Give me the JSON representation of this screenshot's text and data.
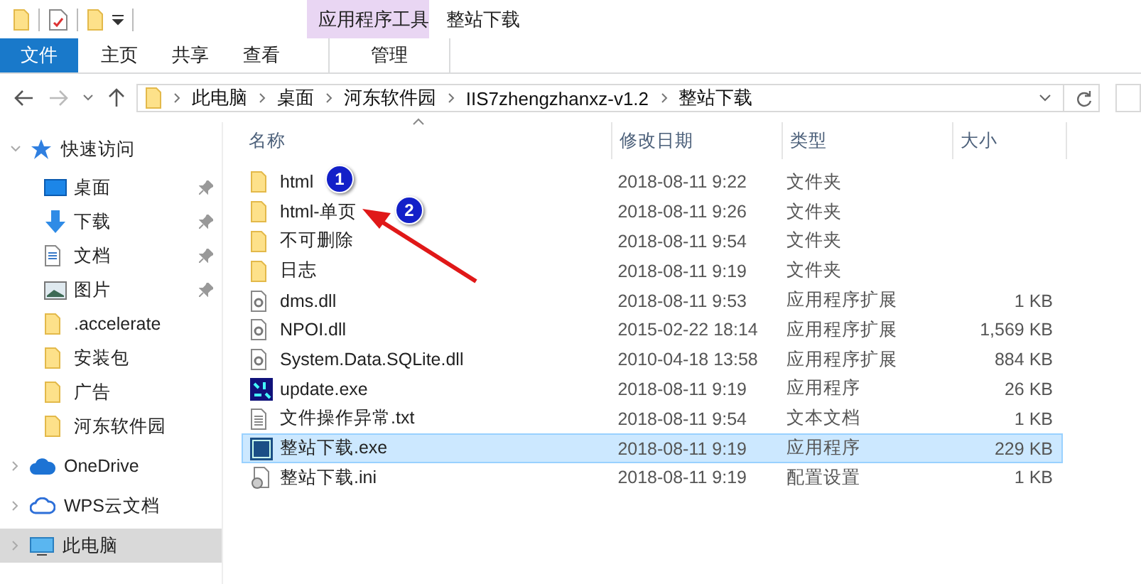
{
  "title_bar": {
    "context_group": "应用程序工具",
    "title": "整站下载"
  },
  "ribbon_tabs": [
    {
      "label": "文件",
      "kind": "file"
    },
    {
      "label": "主页",
      "kind": "normal"
    },
    {
      "label": "共享",
      "kind": "normal"
    },
    {
      "label": "查看",
      "kind": "normal"
    },
    {
      "label": "管理",
      "kind": "context"
    }
  ],
  "address_bar": {
    "crumbs": [
      "此电脑",
      "桌面",
      "河东软件园",
      "IIS7zhengzhanxz-v1.2",
      "整站下载"
    ]
  },
  "nav_pane": [
    {
      "label": "快速访问",
      "kind": "star",
      "expanded": true,
      "selected": false,
      "children": [
        {
          "label": "桌面",
          "kind": "desktop",
          "pinned": true
        },
        {
          "label": "下载",
          "kind": "download",
          "pinned": true
        },
        {
          "label": "文档",
          "kind": "document",
          "pinned": true
        },
        {
          "label": "图片",
          "kind": "image",
          "pinned": true
        },
        {
          "label": ".accelerate",
          "kind": "folder",
          "pinned": false
        },
        {
          "label": "安装包",
          "kind": "folder",
          "pinned": false
        },
        {
          "label": "广告",
          "kind": "folder",
          "pinned": false
        },
        {
          "label": "河东软件园",
          "kind": "folder",
          "pinned": false
        }
      ]
    },
    {
      "label": "OneDrive",
      "kind": "cloud",
      "expanded": false,
      "selected": false
    },
    {
      "label": "WPS云文档",
      "kind": "cloud-outline",
      "expanded": false,
      "selected": false
    },
    {
      "label": "此电脑",
      "kind": "computer",
      "expanded": false,
      "selected": true
    }
  ],
  "columns": [
    {
      "label": "名称",
      "sorted": true
    },
    {
      "label": "修改日期",
      "sorted": false
    },
    {
      "label": "类型",
      "sorted": false
    },
    {
      "label": "大小",
      "sorted": false
    }
  ],
  "files": [
    {
      "name": "html",
      "date": "2018-08-11 9:22",
      "type": "文件夹",
      "kind": "folder",
      "selected": false
    },
    {
      "name": "html-单页",
      "date": "2018-08-11 9:26",
      "type": "文件夹",
      "kind": "folder",
      "selected": false
    },
    {
      "name": "不可删除",
      "date": "2018-08-11 9:54",
      "type": "文件夹",
      "kind": "folder",
      "selected": false
    },
    {
      "name": "日志",
      "date": "2018-08-11 9:19",
      "type": "文件夹",
      "kind": "folder",
      "selected": false
    },
    {
      "name": "dms.dll",
      "date": "2018-08-11 9:53",
      "type": "应用程序扩展",
      "size": "1 KB",
      "kind": "dll",
      "selected": false
    },
    {
      "name": "NPOI.dll",
      "date": "2015-02-22 18:14",
      "type": "应用程序扩展",
      "size": "1,569 KB",
      "kind": "dll",
      "selected": false
    },
    {
      "name": "System.Data.SQLite.dll",
      "date": "2010-04-18 13:58",
      "type": "应用程序扩展",
      "size": "884 KB",
      "kind": "dll",
      "selected": false
    },
    {
      "name": "update.exe",
      "date": "2018-08-11 9:19",
      "type": "应用程序",
      "size": "26 KB",
      "kind": "app",
      "selected": false
    },
    {
      "name": "文件操作异常.txt",
      "date": "2018-08-11 9:54",
      "type": "文本文档",
      "size": "1 KB",
      "kind": "text",
      "selected": false
    },
    {
      "name": "整站下载.exe",
      "date": "2018-08-11 9:19",
      "type": "应用程序",
      "size": "229 KB",
      "kind": "exe",
      "selected": true
    },
    {
      "name": "整站下载.ini",
      "date": "2018-08-11 9:19",
      "type": "配置设置",
      "size": "1 KB",
      "kind": "ini",
      "selected": false
    }
  ],
  "annotations": [
    {
      "number": "1"
    },
    {
      "number": "2"
    }
  ]
}
